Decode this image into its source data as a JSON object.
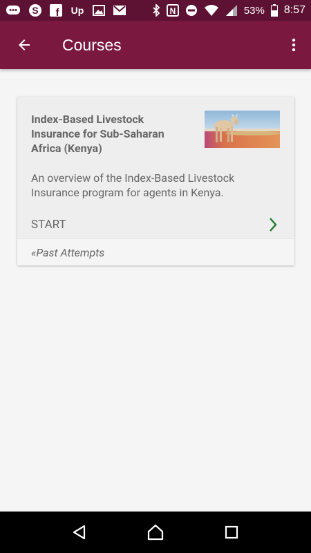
{
  "status_bar": {
    "battery_percent": "53%",
    "time": "8:57",
    "left_icons": [
      "chat-icon",
      "skype-icon",
      "facebook-icon",
      "upwork-icon",
      "image-icon",
      "gmail-icon"
    ],
    "right_icons": [
      "bluetooth-icon",
      "nfc-icon",
      "do-not-disturb-icon",
      "wifi-icon",
      "signal-icon",
      "battery-icon"
    ]
  },
  "app_bar": {
    "title": "Courses",
    "back_icon": "arrow-back-icon",
    "menu_icon": "more-vert-icon"
  },
  "course_card": {
    "title": "Index-Based Livestock Insurance for Sub-Saharan Africa (Kenya)",
    "description": "An overview of the Index-Based Livestock Insurance program for agents in Kenya.",
    "start_label": "START",
    "past_attempts_label": "«Past Attempts",
    "image_icon": "cow-image"
  },
  "nav_bar": {
    "icons": [
      "back-triangle-icon",
      "home-icon",
      "recents-icon"
    ]
  },
  "colors": {
    "status_bar": "#5e1233",
    "app_bar": "#7b1840",
    "chevron_green": "#2e7d32",
    "card_bg": "#eeeeee"
  }
}
